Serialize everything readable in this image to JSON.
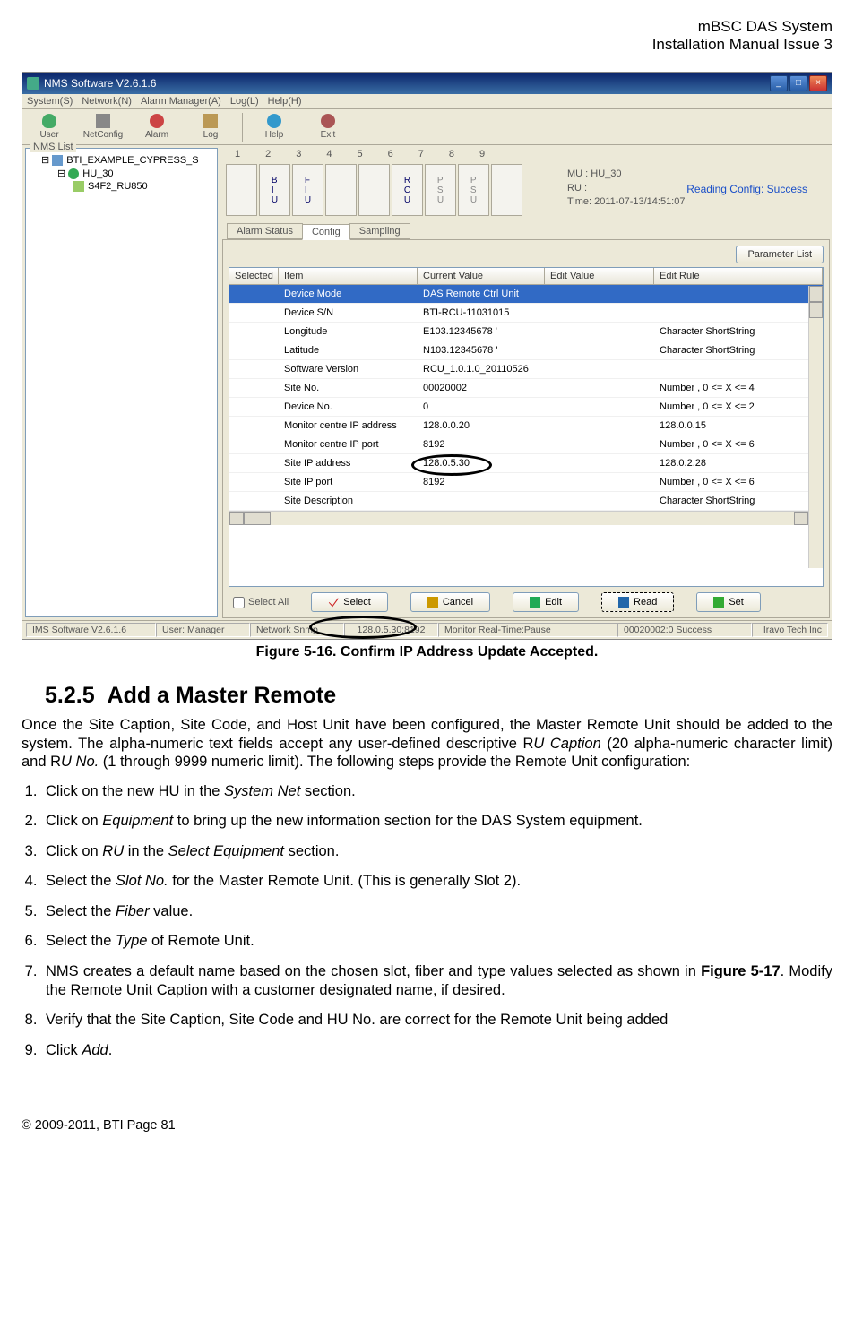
{
  "header": {
    "line1": "mBSC DAS System",
    "line2": "Installation Manual Issue 3"
  },
  "window": {
    "title": "NMS Software V2.6.1.6",
    "menubar": [
      "System(S)",
      "Network(N)",
      "Alarm Manager(A)",
      "Log(L)",
      "Help(H)"
    ],
    "toolbar": [
      "User",
      "NetConfig",
      "Alarm",
      "Log",
      "Help",
      "Exit"
    ],
    "nms_title": "NMS List",
    "tree": {
      "l1": "BTI_EXAMPLE_CYPRESS_S",
      "l2": "HU_30",
      "l3": "S4F2_RU850"
    },
    "slots": [
      "1",
      "2",
      "3",
      "4",
      "5",
      "6",
      "7",
      "8",
      "9"
    ],
    "slot_btns": [
      {
        "t": ""
      },
      {
        "t": "B\nI\nU",
        "active": true
      },
      {
        "t": "F\nI\nU",
        "active": true
      },
      {
        "t": ""
      },
      {
        "t": ""
      },
      {
        "t": "R\nC\nU",
        "active": true
      },
      {
        "t": "P\nS\nU"
      },
      {
        "t": "P\nS\nU"
      },
      {
        "t": ""
      }
    ],
    "info": {
      "mu": "MU :  HU_30",
      "ru": "RU :",
      "time": "Time:  2011-07-13/14:51:07"
    },
    "status_msg": "Reading Config: Success",
    "tabs": [
      "Alarm Status",
      "Config",
      "Sampling"
    ],
    "param_list": "Parameter List",
    "columns": [
      "Selected",
      "Item",
      "Current Value",
      "Edit Value",
      "Edit Rule"
    ],
    "rows": [
      {
        "item": "Device Mode",
        "curr": "DAS Remote Ctrl Unit",
        "edit": "",
        "rule": "",
        "sel": true
      },
      {
        "item": "Device S/N",
        "curr": "BTI-RCU-11031015",
        "edit": "",
        "rule": ""
      },
      {
        "item": "Longitude",
        "curr": "E103.12345678 '",
        "edit": "",
        "rule": "Character ShortString"
      },
      {
        "item": "Latitude",
        "curr": "N103.12345678 '",
        "edit": "",
        "rule": "Character ShortString"
      },
      {
        "item": "Software Version",
        "curr": "RCU_1.0.1.0_20110526",
        "edit": "",
        "rule": ""
      },
      {
        "item": "Site No.",
        "curr": "00020002",
        "edit": "",
        "rule": "Number , 0 <= X <= 4"
      },
      {
        "item": "Device No.",
        "curr": "0",
        "edit": "",
        "rule": "Number , 0 <= X <= 2"
      },
      {
        "item": "Monitor centre IP address",
        "curr": "128.0.0.20",
        "edit": "",
        "rule": "128.0.0.15"
      },
      {
        "item": "Monitor centre IP port",
        "curr": "8192",
        "edit": "",
        "rule": "Number , 0 <= X <= 6"
      },
      {
        "item": "Site IP address",
        "curr": "128.0.5.30",
        "edit": "",
        "rule": "128.0.2.28"
      },
      {
        "item": "Site IP port",
        "curr": "8192",
        "edit": "",
        "rule": "Number , 0 <= X <= 6"
      },
      {
        "item": "Site Description",
        "curr": "",
        "edit": "",
        "rule": "Character ShortString"
      }
    ],
    "select_all": "Select All",
    "buttons": {
      "select": "Select",
      "cancel": "Cancel",
      "edit": "Edit",
      "read": "Read",
      "set": "Set"
    },
    "statusbar": {
      "app": "IMS Software V2.6.1.6",
      "user": "User: Manager",
      "snmp": "Network Snmp",
      "addr": "128.0.5.30:8192",
      "monitor": "Monitor Real-Time:Pause",
      "status": "00020002:0 Success",
      "company": "Iravo Tech Inc"
    }
  },
  "figure_caption": "Figure 5-16. Confirm IP Address Update Accepted.",
  "section_num": "5.2.5",
  "section_title": "Add a Master Remote",
  "body_p1a": "Once the Site Caption, Site Code, and Host Unit have been configured, the Master Remote Unit should be added to the system. The alpha-numeric text fields accept any user-defined descriptive R",
  "body_p1b": "U Caption",
  "body_p1c": " (20 alpha-numeric character limit) and R",
  "body_p1d": "U No.",
  "body_p1e": " (1 through 9999 numeric limit). The following steps provide the Remote Unit configuration:",
  "steps": {
    "s1a": "Click on the new HU in the ",
    "s1b": "System Net",
    "s1c": " section.",
    "s2a": "Click on ",
    "s2b": "Equipment",
    "s2c": " to bring up the new information section for the DAS System equipment.",
    "s3a": "Click on ",
    "s3b": "RU",
    "s3c": " in the ",
    "s3d": "Select Equipment",
    "s3e": " section.",
    "s4a": "Select the ",
    "s4b": "Slot No.",
    "s4c": " for the Master Remote Unit. (This is generally Slot 2).",
    "s5a": "Select the ",
    "s5b": "Fiber",
    "s5c": " value.",
    "s6a": "Select the ",
    "s6b": "Type",
    "s6c": " of Remote Unit.",
    "s7a": "NMS creates a default name based on the chosen slot, fiber and type values selected as shown in ",
    "s7b": "Figure 5-17",
    "s7c": ". Modify the Remote Unit Caption with a customer designated name, if desired.",
    "s8": "Verify that the Site Caption, Site Code and HU No. are correct for the Remote Unit being added",
    "s9a": "Click ",
    "s9b": "Add",
    "s9c": "."
  },
  "footer": "© 2009‐2011, BTI Page 81"
}
